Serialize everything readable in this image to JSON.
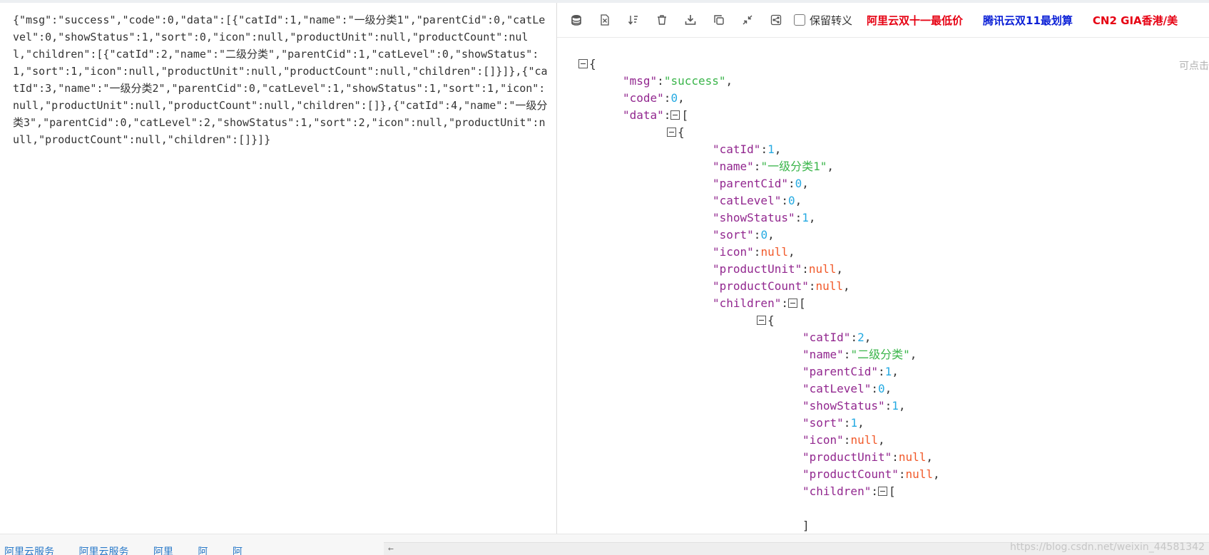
{
  "raw_text": "{\"msg\":\"success\",\"code\":0,\"data\":[{\"catId\":1,\"name\":\"一级分类1\",\"parentCid\":0,\"catLevel\":0,\"showStatus\":1,\"sort\":0,\"icon\":null,\"productUnit\":null,\"productCount\":null,\"children\":[{\"catId\":2,\"name\":\"二级分类\",\"parentCid\":1,\"catLevel\":0,\"showStatus\":1,\"sort\":1,\"icon\":null,\"productUnit\":null,\"productCount\":null,\"children\":[]}]},{\"catId\":3,\"name\":\"一级分类2\",\"parentCid\":0,\"catLevel\":1,\"showStatus\":1,\"sort\":1,\"icon\":null,\"productUnit\":null,\"productCount\":null,\"children\":[]},{\"catId\":4,\"name\":\"一级分类3\",\"parentCid\":0,\"catLevel\":2,\"showStatus\":1,\"sort\":2,\"icon\":null,\"productUnit\":null,\"productCount\":null,\"children\":[]}]}",
  "toolbar": {
    "icons": [
      "database-icon",
      "excel-icon",
      "sort-icon",
      "trash-icon",
      "download-icon",
      "copy-icon",
      "compress-icon",
      "share-icon"
    ],
    "checkbox_label": "保留转义",
    "links": [
      {
        "label": "阿里云双十一最低价",
        "color": "#e60012"
      },
      {
        "label": "腾讯云双11最划算",
        "color": "#0a1fd6"
      },
      {
        "label": "CN2 GIA香港/美",
        "color": "#e60012"
      }
    ]
  },
  "side_hint": "可点击",
  "tree": {
    "root": {
      "msg": "\"success\"",
      "code": "0",
      "data_key": "\"data\"",
      "item": {
        "catId": "1",
        "name": "\"一级分类1\"",
        "parentCid": "0",
        "catLevel": "0",
        "showStatus": "1",
        "sort": "0",
        "icon": "null",
        "productUnit": "null",
        "productCount": "null",
        "children_key": "\"children\"",
        "child": {
          "catId": "2",
          "name": "\"二级分类\"",
          "parentCid": "1",
          "catLevel": "0",
          "showStatus": "1",
          "sort": "1",
          "icon": "null",
          "productUnit": "null",
          "productCount": "null",
          "children_key": "\"children\""
        }
      }
    }
  },
  "keys": {
    "msg": "\"msg\"",
    "code": "\"code\"",
    "catId": "\"catId\"",
    "name": "\"name\"",
    "parentCid": "\"parentCid\"",
    "catLevel": "\"catLevel\"",
    "showStatus": "\"showStatus\"",
    "sort": "\"sort\"",
    "icon": "\"icon\"",
    "productUnit": "\"productUnit\"",
    "productCount": "\"productCount\""
  },
  "bottom": {
    "links": [
      "阿里云服务",
      "阿里云服务",
      "阿里",
      "阿",
      "阿"
    ],
    "watermark": "https://blog.csdn.net/weixin_44581342"
  }
}
